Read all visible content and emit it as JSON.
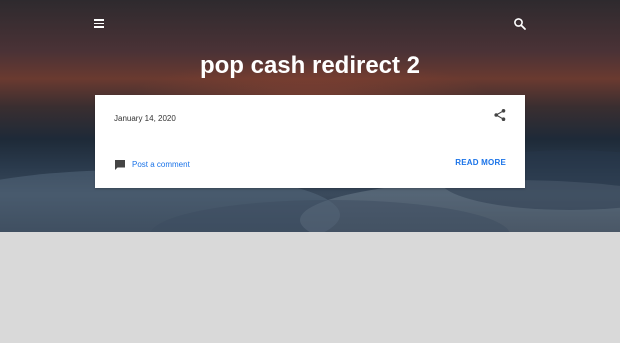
{
  "header": {
    "menu_icon": "hamburger-menu-icon",
    "search_icon": "search-icon"
  },
  "post": {
    "title": "pop cash redirect 2",
    "date": "January 14, 2020",
    "share_icon": "share-icon",
    "comment_icon": "comment-icon",
    "comment_label": "Post a comment",
    "read_more_label": "READ MORE"
  },
  "colors": {
    "link": "#1a73e8",
    "page_background": "#d9d9d9",
    "card_background": "#ffffff"
  }
}
